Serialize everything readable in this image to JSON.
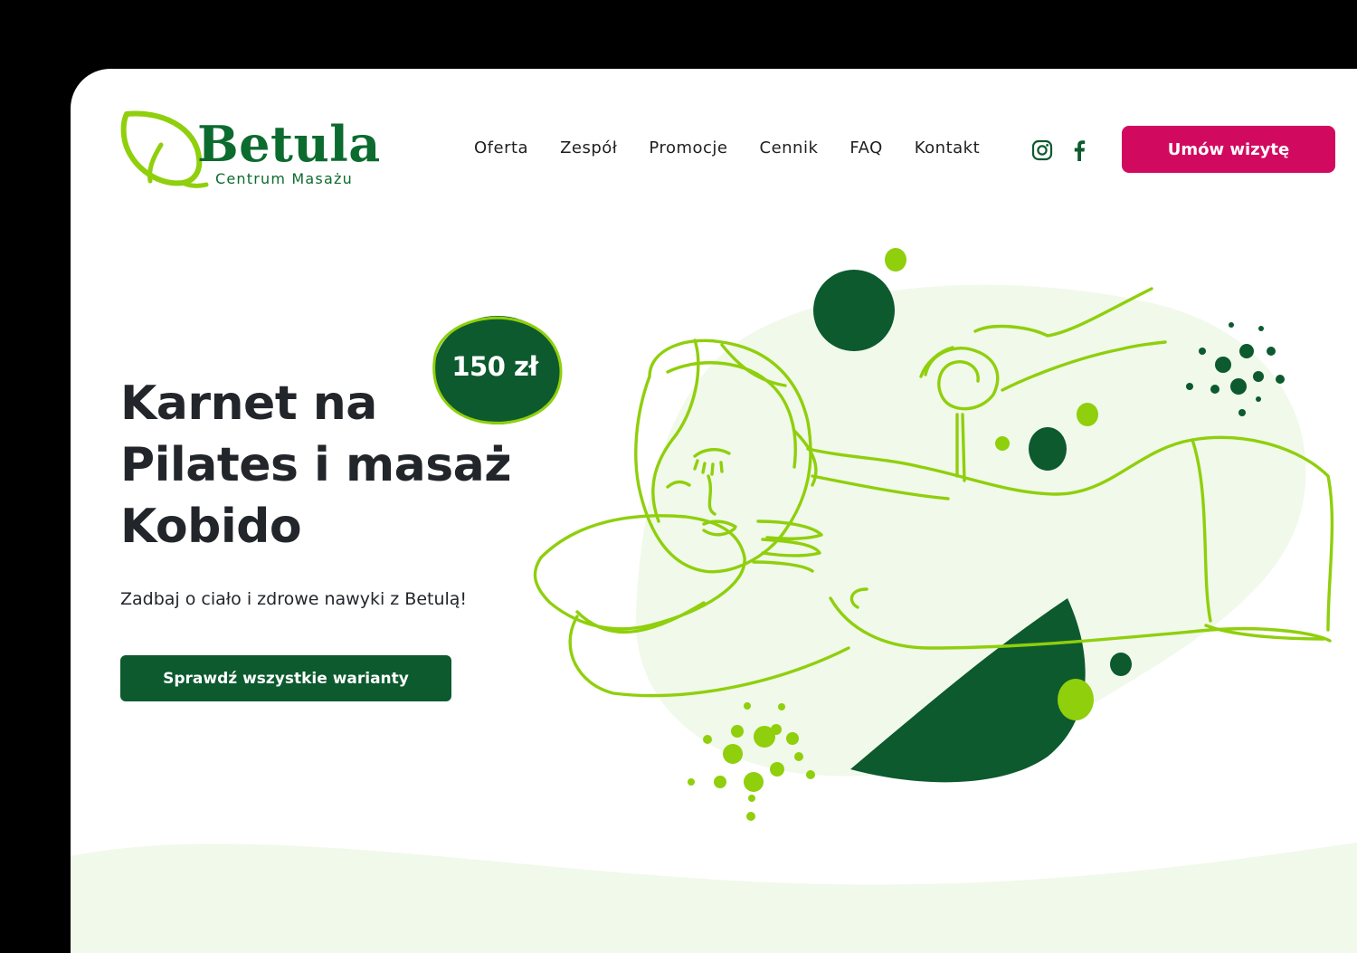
{
  "brand": {
    "name": "Betula",
    "tagline": "Centrum Masażu",
    "logo_icon": "leaf-icon"
  },
  "nav": {
    "items": [
      {
        "label": "Oferta"
      },
      {
        "label": "Zespół"
      },
      {
        "label": "Promocje"
      },
      {
        "label": "Cennik"
      },
      {
        "label": "FAQ"
      },
      {
        "label": "Kontakt"
      }
    ],
    "social": [
      "instagram-icon",
      "facebook-icon"
    ]
  },
  "header": {
    "cta_label": "Umów wizytę"
  },
  "hero": {
    "price": "150 zł",
    "title": "Karnet na Pilates i masaż Kobido",
    "subtitle": "Zadbaj o ciało i zdrowe nawyki z Betulą!",
    "button_label": "Sprawdź wszystkie warianty",
    "illustration": "massage-illustration"
  },
  "colors": {
    "brand_dark_green": "#0c5a2e",
    "brand_lime": "#8fcf0c",
    "accent_pink": "#d20a5f",
    "soft_green": "#f1f9ea",
    "text_dark": "#22252a"
  }
}
